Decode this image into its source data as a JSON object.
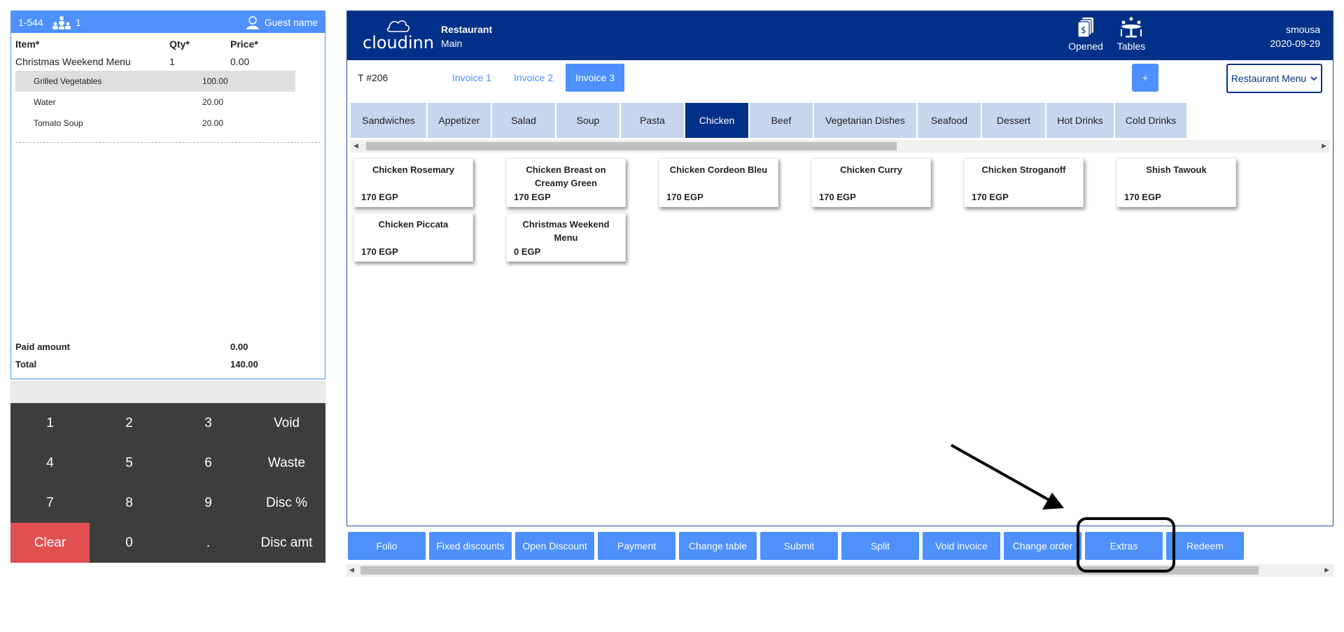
{
  "ticket": {
    "table_code": "1-544",
    "guests": "1",
    "guest_name": "Guest name",
    "headers": {
      "item": "Item*",
      "qty": "Qty*",
      "price": "Price*"
    },
    "main_item": {
      "name": "Christmas Weekend Menu",
      "qty": "1",
      "price": "0.00"
    },
    "sub_items": [
      {
        "name": "Grilled Vegetables",
        "price": "100.00"
      },
      {
        "name": "Water",
        "price": "20.00"
      },
      {
        "name": "Tomato Soup",
        "price": "20.00"
      }
    ],
    "paid_label": "Paid amount",
    "paid_value": "0.00",
    "total_label": "Total",
    "total_value": "140.00"
  },
  "keypad": {
    "keys": [
      "1",
      "2",
      "3",
      "Void",
      "4",
      "5",
      "6",
      "Waste",
      "7",
      "8",
      "9",
      "Disc %",
      "Clear",
      "0",
      ".",
      "Disc amt"
    ]
  },
  "topbar": {
    "logo_text": "cloudinn",
    "outlet": "Restaurant",
    "section": "Main",
    "opened_label": "Opened",
    "tables_label": "Tables",
    "username": "smousa",
    "date": "2020-09-29",
    "brand_color": "#003087"
  },
  "invoice_row": {
    "table_number": "T #206",
    "tabs": [
      "Invoice 1",
      "Invoice 2",
      "Invoice 3"
    ],
    "active_tab": "Invoice 3",
    "plus_label": "+",
    "menu_select": "Restaurant Menu"
  },
  "categories": [
    "Sandwiches",
    "Appetizer",
    "Salad",
    "Soup",
    "Pasta",
    "Chicken",
    "Beef",
    "Vegetarian Dishes",
    "Seafood",
    "Dessert",
    "Hot Drinks",
    "Cold Drinks"
  ],
  "active_category": "Chicken",
  "products": [
    {
      "name": "Chicken Rosemary",
      "price": "170 EGP"
    },
    {
      "name": "Chicken Breast on Creamy Green",
      "price": "170 EGP"
    },
    {
      "name": "Chicken Cordeon Bleu",
      "price": "170 EGP"
    },
    {
      "name": "Chicken Curry",
      "price": "170 EGP"
    },
    {
      "name": "Chicken Stroganoff",
      "price": "170 EGP"
    },
    {
      "name": "Shish Tawouk",
      "price": "170 EGP"
    },
    {
      "name": "Chicken Piccata",
      "price": "170 EGP"
    },
    {
      "name": "Christmas Weekend Menu",
      "price": "0 EGP"
    }
  ],
  "actions": [
    "Folio",
    "Fixed discounts",
    "Open Discount",
    "Payment",
    "Change table",
    "Submit",
    "Split",
    "Void invoice",
    "Change order",
    "Extras",
    "Redeem"
  ],
  "accent_color": "#4d90fe",
  "highlighted_action": "Extras"
}
